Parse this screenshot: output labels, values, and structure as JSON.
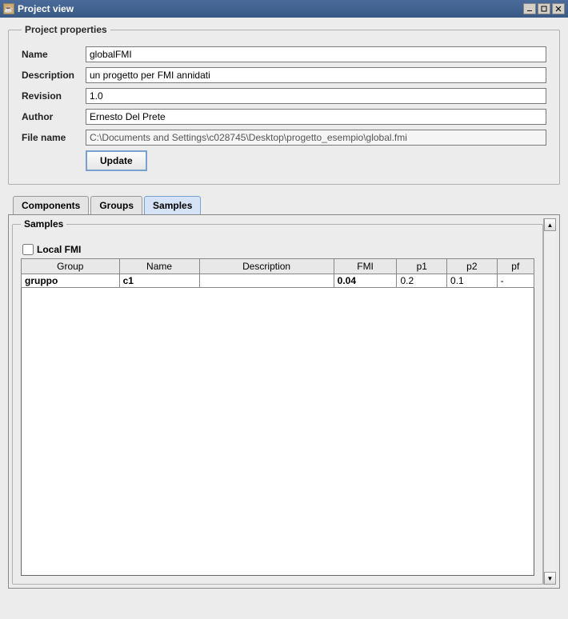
{
  "window": {
    "title": "Project view"
  },
  "props": {
    "legend": "Project properties",
    "labels": {
      "name": "Name",
      "description": "Description",
      "revision": "Revision",
      "author": "Author",
      "filename": "File name"
    },
    "values": {
      "name": "globalFMI",
      "description": "un progetto per FMI annidati",
      "revision": "1.0",
      "author": "Ernesto Del Prete",
      "filename": "C:\\Documents and Settings\\c028745\\Desktop\\progetto_esempio\\global.fmi"
    },
    "update": "Update"
  },
  "tabs": {
    "components": "Components",
    "groups": "Groups",
    "samples": "Samples"
  },
  "samples": {
    "legend": "Samples",
    "localFMI": "Local FMI",
    "headers": {
      "group": "Group",
      "name": "Name",
      "description": "Description",
      "fmi": "FMI",
      "p1": "p1",
      "p2": "p2",
      "pf": "pf"
    },
    "row0": {
      "group": "gruppo",
      "name": "c1",
      "description": "",
      "fmi": "0.04",
      "p1": "0.2",
      "p2": "0.1",
      "pf": "-"
    }
  }
}
